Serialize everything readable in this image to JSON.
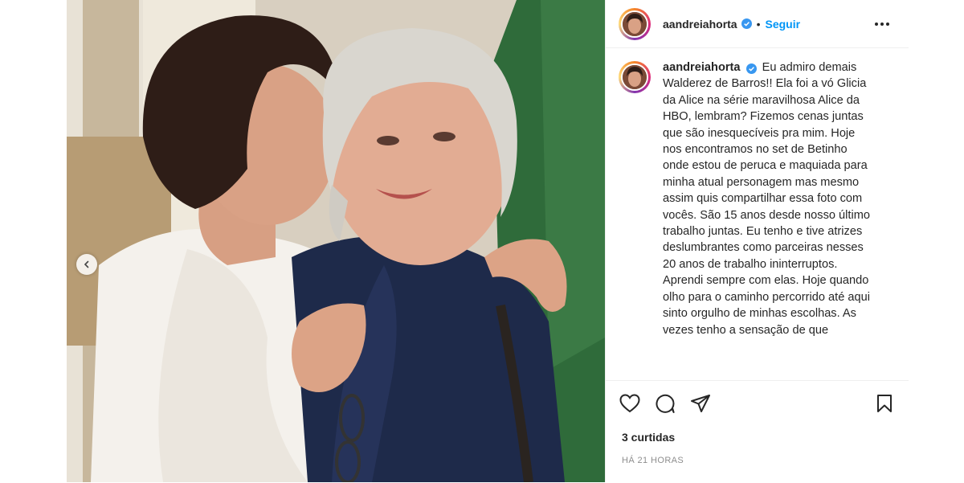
{
  "post": {
    "username": "aandreiahorta",
    "follow_label": "Seguir",
    "separator": "•",
    "caption": "Eu admiro demais Walderez de Barros!! Ela foi a vó Glicia da Alice na série maravilhosa Alice da HBO, lembram? Fizemos cenas juntas que são inesquecíveis pra mim. Hoje nos encontramos no set de Betinho onde estou de peruca e maquiada para minha atual personagem mas mesmo assim quis compartilhar essa foto com vocês. São 15 anos desde nosso último trabalho juntas. Eu tenho e tive atrizes deslumbrantes como parceiras nesses 20 anos de trabalho ininterruptos. Aprendi sempre com elas. Hoje quando olho para o caminho percorrido até aqui sinto orgulho de minhas escolhas. As vezes tenho a sensação de que",
    "likes": "3 curtidas",
    "time": "HÁ 21 HORAS"
  },
  "icons": {
    "prev": "chevron-left-icon",
    "like": "heart-icon",
    "comment": "comment-icon",
    "share": "paper-plane-icon",
    "save": "bookmark-icon",
    "more": "more-options-icon",
    "verified": "verified-badge-icon"
  },
  "colors": {
    "link": "#0095f6",
    "text": "#262626",
    "muted": "#8e8e8e",
    "verified": "#3897f0",
    "wall_green": "#2f6b3a"
  }
}
